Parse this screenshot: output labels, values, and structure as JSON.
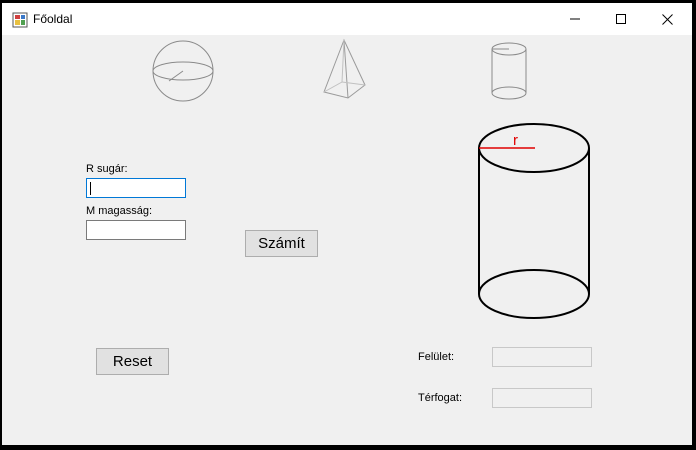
{
  "window": {
    "title": "Főoldal"
  },
  "icons": {
    "app": "app-icon",
    "minimize": "minimize-icon",
    "maximize": "maximize-icon",
    "close": "close-icon",
    "sphere": "sphere-icon",
    "pyramid": "pyramid-icon",
    "cylinder": "cylinder-icon"
  },
  "form": {
    "radius_label": "R sugár:",
    "radius_value": "",
    "height_label": "M magasság:",
    "height_value": "",
    "compute_button": "Számít",
    "reset_button": "Reset"
  },
  "diagram": {
    "radius_marker": "r",
    "radius_color": "#e00000"
  },
  "results": {
    "surface_label": "Felület:",
    "surface_value": "",
    "volume_label": "Térfogat:",
    "volume_value": ""
  }
}
